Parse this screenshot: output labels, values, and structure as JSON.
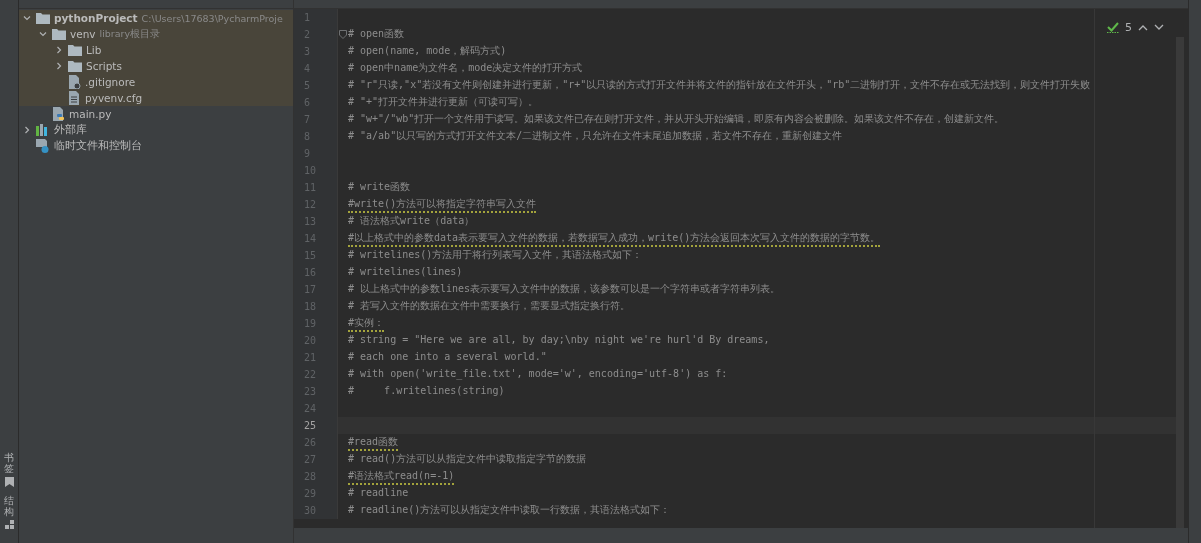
{
  "tool_strip": [
    {
      "label": "书签",
      "kind": "bookmark"
    },
    {
      "label": "结构",
      "kind": "structure"
    }
  ],
  "project_tree": [
    {
      "name": "pythonProject",
      "hint": "C:\\Users\\17683\\PycharmProje",
      "kind": "folder",
      "expanded": true,
      "highlighted": true,
      "children": [
        {
          "name": "venv",
          "hint": "library根目录",
          "kind": "folder",
          "expanded": true,
          "highlighted": true,
          "children": [
            {
              "name": "Lib",
              "kind": "folder",
              "expanded": false,
              "highlighted": true
            },
            {
              "name": "Scripts",
              "kind": "folder",
              "expanded": false,
              "highlighted": true
            },
            {
              "name": ".gitignore",
              "kind": "ignored-file",
              "highlighted": true
            },
            {
              "name": "pyvenv.cfg",
              "kind": "text-file",
              "highlighted": true
            }
          ]
        },
        {
          "name": "main.py",
          "kind": "python-file",
          "highlighted": false
        }
      ]
    },
    {
      "name": "外部库",
      "kind": "library",
      "expanded": false,
      "highlighted": false
    },
    {
      "name": "临时文件和控制台",
      "kind": "scratches",
      "highlighted": false
    }
  ],
  "editor": {
    "inspections": {
      "count": "5"
    },
    "lines": [
      {
        "number": "1",
        "current": false
      },
      {
        "number": "2",
        "text": "# open函数",
        "current": false,
        "warning": false,
        "fold": true
      },
      {
        "number": "3",
        "text": "# open(name, mode，解码方式)",
        "current": false,
        "warning": false
      },
      {
        "number": "4",
        "text": "# open中name为文件名，mode决定文件的打开方式",
        "current": false,
        "warning": false
      },
      {
        "number": "5",
        "text": "# \"r\"只读,\"x\"若没有文件则创建并进行更新，\"r+\"以只读的方式打开文件并将文件的指针放在文件开头，\"rb\"二进制打开，文件不存在或无法找到，则文件打开失败",
        "current": false,
        "warning": false
      },
      {
        "number": "6",
        "text": "# \"+\"打开文件并进行更新（可读可写）。",
        "current": false,
        "warning": false
      },
      {
        "number": "7",
        "text": "# \"w+\"/\"wb\"打开一个文件用于读写。如果该文件已存在则打开文件，并从开头开始编辑，即原有内容会被删除。如果该文件不存在，创建新文件。",
        "current": false,
        "warning": false
      },
      {
        "number": "8",
        "text": "# \"a/ab\"以只写的方式打开文件文本/二进制文件，只允许在文件末尾追加数据，若文件不存在，重新创建文件",
        "current": false,
        "warning": false
      },
      {
        "number": "9",
        "current": false
      },
      {
        "number": "10",
        "current": false
      },
      {
        "number": "11",
        "text": "# write函数",
        "current": false,
        "warning": false
      },
      {
        "number": "12",
        "text": "#write()方法可以将指定字符串写入文件",
        "current": false,
        "warning": true
      },
      {
        "number": "13",
        "text": "# 语法格式write（data）",
        "current": false,
        "warning": false
      },
      {
        "number": "14",
        "text": "#以上格式中的参数data表示要写入文件的数据，若数据写入成功，write()方法会返回本次写入文件的数据的字节数。",
        "current": false,
        "warning": true
      },
      {
        "number": "15",
        "text": "# writelines()方法用于将行列表写入文件，其语法格式如下：",
        "current": false,
        "warning": false
      },
      {
        "number": "16",
        "text": "# writelines(lines)",
        "current": false,
        "warning": false
      },
      {
        "number": "17",
        "text": "# 以上格式中的参数lines表示要写入文件中的数据，该参数可以是一个字符串或者字符串列表。",
        "current": false,
        "warning": false
      },
      {
        "number": "18",
        "text": "# 若写入文件的数据在文件中需要换行，需要显式指定换行符。",
        "current": false,
        "warning": false
      },
      {
        "number": "19",
        "text": "#实例：",
        "current": false,
        "warning": true
      },
      {
        "number": "20",
        "text": "# string = \"Here we are all, by day;\\nby night we're hurl'd By dreams,",
        "current": false,
        "warning": false
      },
      {
        "number": "21",
        "text": "# each one into a several world.\"",
        "current": false,
        "warning": false
      },
      {
        "number": "22",
        "text": "# with open('write_file.txt', mode='w', encoding='utf-8') as f:",
        "current": false,
        "warning": false
      },
      {
        "number": "23",
        "text": "#     f.writelines(string)",
        "current": false,
        "warning": false
      },
      {
        "number": "24",
        "current": false
      },
      {
        "number": "25",
        "current": true
      },
      {
        "number": "26",
        "text": "#read函数",
        "current": false,
        "warning": true
      },
      {
        "number": "27",
        "text": "# read()方法可以从指定文件中读取指定字节的数据",
        "current": false,
        "warning": false
      },
      {
        "number": "28",
        "text": "#语法格式read(n=-1)",
        "current": false,
        "warning": true
      },
      {
        "number": "29",
        "text": "# readline",
        "current": false,
        "warning": false
      },
      {
        "number": "30",
        "text": "# readline()方法可以从指定文件中读取一行数据，其语法格式如下：",
        "current": false,
        "warning": false
      }
    ]
  }
}
